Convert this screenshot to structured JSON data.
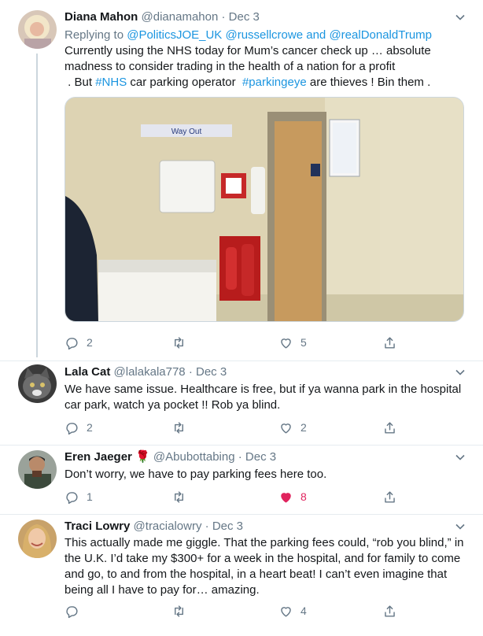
{
  "tweets": [
    {
      "name": "Diana Mahon",
      "handle": "@dianamahon",
      "date": "Dec 3",
      "replying_prefix": "Replying to",
      "replying_1": "@PoliticsJOE_UK",
      "replying_2": "@russellcrowe",
      "replying_and": "and",
      "replying_3": "@realDonaldTrump",
      "text_line1": "Currently using the NHS today for Mum’s cancer check up … absolute",
      "text_line2": "madness to consider trading in  the health of a nation  for a profit",
      "text_line3_a": " . But ",
      "hashtag_1": "#NHS",
      "text_line3_b": " car parking operator  ",
      "hashtag_2": "#parkingeye",
      "text_line3_c": " are thieves ! Bin them .",
      "photo_sign": "Way Out",
      "replies": "2",
      "retweets": "",
      "likes": "5"
    },
    {
      "name": "Lala Cat",
      "handle": "@lalakala778",
      "date": "Dec 3",
      "text_line1": "We have same issue. Healthcare is free, but if ya wanna park in the hospital",
      "text_line2": "car park, watch ya pocket !! Rob ya blind.",
      "replies": "2",
      "retweets": "",
      "likes": "2"
    },
    {
      "name": "Eren Jaeger",
      "name_emoji": "🌹",
      "handle": "@Abubottabing",
      "date": "Dec 3",
      "text_line1": "Don’t worry, we have to pay parking fees here too.",
      "replies": "1",
      "retweets": "",
      "likes": "8"
    },
    {
      "name": "Traci Lowry",
      "handle": "@tracialowry",
      "date": "Dec 3",
      "text_line1": "This actually made me giggle. That the parking fees could, “rob you blind,” in",
      "text_line2": "the U.K.  I’d take my $300+ for a week in the hospital, and for family to come",
      "text_line3": "and go, to and from the hospital, in a heart beat! I can’t even imagine that",
      "text_line4": "being all I have to pay for… amazing.",
      "replies": "",
      "retweets": "",
      "likes": "4"
    }
  ],
  "separator": "·",
  "colors": {
    "link": "#1b95e0",
    "secondary": "#657786",
    "like": "#e0245e",
    "border": "#e6ecf0"
  },
  "icons": [
    "reply-icon",
    "retweet-icon",
    "like-icon",
    "share-icon",
    "chevron-down-icon"
  ]
}
